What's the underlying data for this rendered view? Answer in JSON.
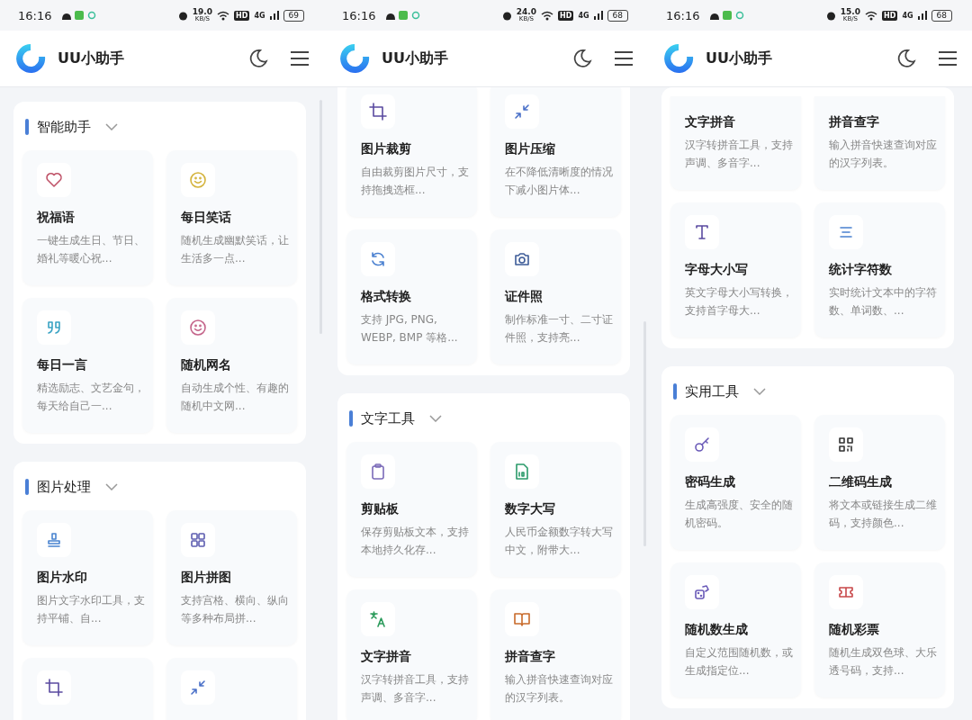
{
  "screens": [
    {
      "status": {
        "time": "16:16",
        "speed": "19.0",
        "speed_unit": "KB/S",
        "hd": "HD",
        "network": "4G",
        "battery": "69"
      },
      "app_title": "UU小助手",
      "panels": [
        {
          "title": "智能助手",
          "cards": [
            {
              "kind": "heart",
              "title": "祝福语",
              "desc": "一键生成生日、节日、婚礼等暖心祝..."
            },
            {
              "kind": "smile",
              "title": "每日笑话",
              "desc": "随机生成幽默笑话，让生活多一点..."
            },
            {
              "kind": "quote",
              "title": "每日一言",
              "desc": "精选励志、文艺金句，每天给自己一..."
            },
            {
              "kind": "smile-pink",
              "title": "随机网名",
              "desc": "自动生成个性、有趣的随机中文网..."
            }
          ]
        },
        {
          "title": "图片处理",
          "cards": [
            {
              "kind": "stamp",
              "title": "图片水印",
              "desc": "图片文字水印工具，支持平铺、自..."
            },
            {
              "kind": "grid",
              "title": "图片拼图",
              "desc": "支持宫格、横向、纵向等多种布局拼..."
            },
            {
              "kind": "crop"
            },
            {
              "kind": "compress"
            }
          ]
        }
      ]
    },
    {
      "status": {
        "time": "16:16",
        "speed": "24.0",
        "speed_unit": "KB/S",
        "hd": "HD",
        "network": "4G",
        "battery": "68"
      },
      "app_title": "UU小助手",
      "panels": [
        {
          "cards": [
            {
              "kind": "crop",
              "title": "图片裁剪",
              "desc": "自由裁剪图片尺寸，支持拖拽选框..."
            },
            {
              "kind": "compress",
              "title": "图片压缩",
              "desc": "在不降低清晰度的情况下减小图片体..."
            },
            {
              "kind": "refresh",
              "title": "格式转换",
              "desc": "支持 JPG, PNG, WEBP, BMP 等格..."
            },
            {
              "kind": "camera",
              "title": "证件照",
              "desc": "制作标准一寸、二寸证件照，支持亮..."
            }
          ]
        },
        {
          "title": "文字工具",
          "cards": [
            {
              "kind": "clipboard",
              "title": "剪贴板",
              "desc": "保存剪贴板文本，支持本地持久化存..."
            },
            {
              "kind": "binary",
              "title": "数字大写",
              "desc": "人民币金额数字转大写中文，附带大..."
            },
            {
              "kind": "translate",
              "title": "文字拼音",
              "desc": "汉字转拼音工具，支持声调、多音字..."
            },
            {
              "kind": "book",
              "title": "拼音查字",
              "desc": "输入拼音快速查询对应的汉字列表。"
            }
          ]
        }
      ]
    },
    {
      "status": {
        "time": "16:16",
        "speed": "15.0",
        "speed_unit": "KB/S",
        "hd": "HD",
        "network": "4G",
        "battery": "68"
      },
      "app_title": "UU小助手",
      "panels": [
        {
          "cards": [
            {
              "title": "文字拼音",
              "desc": "汉字转拼音工具，支持声调、多音字..."
            },
            {
              "title": "拼音查字",
              "desc": "输入拼音快速查询对应的汉字列表。"
            },
            {
              "kind": "letter-t",
              "title": "字母大小写",
              "desc": "英文字母大小写转换，支持首字母大..."
            },
            {
              "kind": "lines",
              "title": "统计字符数",
              "desc": "实时统计文本中的字符数、单词数、..."
            }
          ]
        },
        {
          "title": "实用工具",
          "cards": [
            {
              "kind": "key",
              "title": "密码生成",
              "desc": "生成高强度、安全的随机密码。"
            },
            {
              "kind": "qrcode",
              "title": "二维码生成",
              "desc": "将文本或链接生成二维码，支持颜色..."
            },
            {
              "kind": "dice",
              "title": "随机数生成",
              "desc": "自定义范围随机数，或生成指定位..."
            },
            {
              "kind": "ticket",
              "title": "随机彩票",
              "desc": "随机生成双色球、大乐透号码，支持..."
            }
          ]
        }
      ]
    }
  ]
}
